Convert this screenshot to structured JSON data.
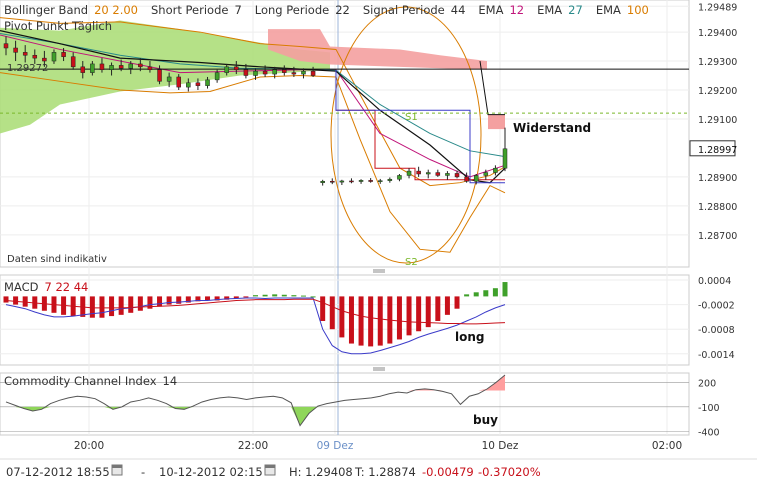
{
  "header_items": [
    {
      "label": "Bollinger Band",
      "params": "20  2.00",
      "label_color": "#333333",
      "param_color": "#d97c00"
    },
    {
      "label": "Short Periode",
      "params": "7",
      "label_color": "#333333",
      "param_color": "#333333"
    },
    {
      "label": "Long Periode",
      "params": "22",
      "label_color": "#333333",
      "param_color": "#333333"
    },
    {
      "label": "Signal Periode",
      "params": "44",
      "label_color": "#333333",
      "param_color": "#333333"
    },
    {
      "label": "EMA",
      "params": "12",
      "label_color": "#333333",
      "param_color": "#c0157a"
    },
    {
      "label": "EMA",
      "params": "27",
      "label_color": "#333333",
      "param_color": "#2a8a8a"
    },
    {
      "label": "EMA",
      "params": "100",
      "label_color": "#333333",
      "param_color": "#d97c00"
    }
  ],
  "pivot_label": "Pivot Punkt Täglich",
  "pivot_value_label": "1.29272",
  "note": "Daten sind indikativ",
  "annotations": {
    "s1": "S1",
    "s2": "S2",
    "widerstand": "Widerstand",
    "long": "long",
    "buy": "buy"
  },
  "macd_label": "MACD",
  "macd_params": "7  22  44",
  "cci_label": "Commodity Channel Index",
  "cci_params": "14",
  "time_labels": [
    "20:00",
    "22:00",
    "09 Dez",
    "10 Dez",
    "02:00"
  ],
  "footer": {
    "from": "07-12-2012 18:55",
    "dash": "-",
    "to": "10-12-2012 02:15",
    "high": "H: 1.29408",
    "low": "T: 1.28874",
    "change": "-0.00479",
    "change_pct": "-0.37020%"
  },
  "colors": {
    "up": "#3fa02a",
    "down": "#c8101a",
    "price_box": "#333333",
    "macd_line": "#3b3bc9",
    "macd_signal": "#c8101a",
    "cci_fill": "#8fd65a",
    "cci_neg_fill": "#ff9e9e",
    "cloud_green": "#a8dc72",
    "cloud_red": "#f4a0a0",
    "bollinger": "#d97c00"
  },
  "chart_data": [
    {
      "type": "candlestick",
      "title": "",
      "x_tick_labels": [
        "20:00",
        "22:00",
        "09 Dez",
        "10 Dez",
        "02:00"
      ],
      "y_tick_labels": [
        "1.29489",
        "1.29400",
        "1.29300",
        "1.29200",
        "1.29100",
        "1.28900",
        "1.28800",
        "1.28700"
      ],
      "ylim": [
        1.2862,
        1.2949
      ],
      "last_price": "1.28997",
      "pivot": 1.29272,
      "s1": 1.2912,
      "candles": [
        {
          "o": 1.2936,
          "h": 1.29385,
          "l": 1.2932,
          "c": 1.29345
        },
        {
          "o": 1.29345,
          "h": 1.2937,
          "l": 1.293,
          "c": 1.2933
        },
        {
          "o": 1.2933,
          "h": 1.29355,
          "l": 1.29295,
          "c": 1.2932
        },
        {
          "o": 1.2932,
          "h": 1.2934,
          "l": 1.2929,
          "c": 1.2931
        },
        {
          "o": 1.2931,
          "h": 1.29335,
          "l": 1.2928,
          "c": 1.293
        },
        {
          "o": 1.293,
          "h": 1.2934,
          "l": 1.2929,
          "c": 1.2933
        },
        {
          "o": 1.2933,
          "h": 1.29345,
          "l": 1.293,
          "c": 1.29315
        },
        {
          "o": 1.29315,
          "h": 1.2933,
          "l": 1.2927,
          "c": 1.2928
        },
        {
          "o": 1.2928,
          "h": 1.293,
          "l": 1.2924,
          "c": 1.2926
        },
        {
          "o": 1.2926,
          "h": 1.293,
          "l": 1.2925,
          "c": 1.2929
        },
        {
          "o": 1.2929,
          "h": 1.2931,
          "l": 1.2926,
          "c": 1.2927
        },
        {
          "o": 1.2927,
          "h": 1.29295,
          "l": 1.2925,
          "c": 1.29285
        },
        {
          "o": 1.29285,
          "h": 1.29305,
          "l": 1.29265,
          "c": 1.29275
        },
        {
          "o": 1.29275,
          "h": 1.293,
          "l": 1.29255,
          "c": 1.2929
        },
        {
          "o": 1.2929,
          "h": 1.2931,
          "l": 1.29265,
          "c": 1.2928
        },
        {
          "o": 1.2928,
          "h": 1.293,
          "l": 1.2926,
          "c": 1.2927
        },
        {
          "o": 1.2927,
          "h": 1.29285,
          "l": 1.2922,
          "c": 1.2923
        },
        {
          "o": 1.2923,
          "h": 1.2926,
          "l": 1.2921,
          "c": 1.29245
        },
        {
          "o": 1.29245,
          "h": 1.29255,
          "l": 1.292,
          "c": 1.2921
        },
        {
          "o": 1.2921,
          "h": 1.2924,
          "l": 1.29195,
          "c": 1.29225
        },
        {
          "o": 1.29225,
          "h": 1.2924,
          "l": 1.292,
          "c": 1.29215
        },
        {
          "o": 1.29215,
          "h": 1.29245,
          "l": 1.29205,
          "c": 1.29235
        },
        {
          "o": 1.29235,
          "h": 1.2927,
          "l": 1.29225,
          "c": 1.2926
        },
        {
          "o": 1.2926,
          "h": 1.2929,
          "l": 1.2925,
          "c": 1.2928
        },
        {
          "o": 1.2928,
          "h": 1.293,
          "l": 1.29255,
          "c": 1.2927
        },
        {
          "o": 1.2927,
          "h": 1.2929,
          "l": 1.2924,
          "c": 1.2925
        },
        {
          "o": 1.2925,
          "h": 1.29275,
          "l": 1.29235,
          "c": 1.29265
        },
        {
          "o": 1.29265,
          "h": 1.29285,
          "l": 1.29245,
          "c": 1.29255
        },
        {
          "o": 1.29255,
          "h": 1.2928,
          "l": 1.2924,
          "c": 1.2927
        },
        {
          "o": 1.2927,
          "h": 1.29285,
          "l": 1.2925,
          "c": 1.2926
        },
        {
          "o": 1.2926,
          "h": 1.2928,
          "l": 1.29245,
          "c": 1.29255
        },
        {
          "o": 1.29255,
          "h": 1.29275,
          "l": 1.2924,
          "c": 1.29265
        },
        {
          "o": 1.29265,
          "h": 1.2928,
          "l": 1.29245,
          "c": 1.2925
        },
        {
          "o": 1.2888,
          "h": 1.2889,
          "l": 1.2887,
          "c": 1.28885
        },
        {
          "o": 1.28885,
          "h": 1.28895,
          "l": 1.28875,
          "c": 1.28882
        },
        {
          "o": 1.28882,
          "h": 1.2889,
          "l": 1.28872,
          "c": 1.28886
        },
        {
          "o": 1.28886,
          "h": 1.28895,
          "l": 1.28878,
          "c": 1.28884
        },
        {
          "o": 1.28884,
          "h": 1.28892,
          "l": 1.28876,
          "c": 1.28888
        },
        {
          "o": 1.28888,
          "h": 1.28896,
          "l": 1.2888,
          "c": 1.28884
        },
        {
          "o": 1.28884,
          "h": 1.28893,
          "l": 1.28876,
          "c": 1.28887
        },
        {
          "o": 1.28887,
          "h": 1.28898,
          "l": 1.2888,
          "c": 1.28892
        },
        {
          "o": 1.28892,
          "h": 1.2891,
          "l": 1.28885,
          "c": 1.28905
        },
        {
          "o": 1.28905,
          "h": 1.2893,
          "l": 1.28895,
          "c": 1.2892
        },
        {
          "o": 1.2892,
          "h": 1.28935,
          "l": 1.289,
          "c": 1.2891
        },
        {
          "o": 1.2891,
          "h": 1.28925,
          "l": 1.28895,
          "c": 1.28915
        },
        {
          "o": 1.28915,
          "h": 1.28925,
          "l": 1.289,
          "c": 1.28905
        },
        {
          "o": 1.28905,
          "h": 1.2892,
          "l": 1.2889,
          "c": 1.28912
        },
        {
          "o": 1.28912,
          "h": 1.28922,
          "l": 1.28895,
          "c": 1.289
        },
        {
          "o": 1.289,
          "h": 1.28915,
          "l": 1.2888,
          "c": 1.28885
        },
        {
          "o": 1.28885,
          "h": 1.2891,
          "l": 1.28874,
          "c": 1.28905
        },
        {
          "o": 1.28905,
          "h": 1.28925,
          "l": 1.2889,
          "c": 1.28915
        },
        {
          "o": 1.28915,
          "h": 1.2894,
          "l": 1.28905,
          "c": 1.2893
        },
        {
          "o": 1.2893,
          "h": 1.2907,
          "l": 1.2892,
          "c": 1.28997
        }
      ]
    },
    {
      "type": "bar",
      "title": "MACD",
      "y_tick_labels": [
        "0.0004",
        "-0.0002",
        "-0.0008",
        "-0.0014"
      ],
      "ylim": [
        -0.0016,
        0.0004
      ],
      "histogram": [
        -0.00015,
        -0.0002,
        -0.00025,
        -0.0003,
        -0.00035,
        -0.0004,
        -0.00045,
        -0.00048,
        -0.0005,
        -0.00052,
        -0.00052,
        -0.00048,
        -0.00045,
        -0.0004,
        -0.00035,
        -0.0003,
        -0.00025,
        -0.0002,
        -0.00018,
        -0.00015,
        -0.00012,
        -0.0001,
        -0.0001,
        -8e-05,
        -5e-05,
        -2e-05,
        3e-05,
        4e-05,
        5e-05,
        4e-05,
        3e-05,
        2e-05,
        0.0,
        -0.0006,
        -0.0008,
        -0.001,
        -0.00115,
        -0.0012,
        -0.00122,
        -0.0012,
        -0.00115,
        -0.00105,
        -0.00095,
        -0.00085,
        -0.00075,
        -0.0006,
        -0.00045,
        -0.0003,
        5e-05,
        0.0001,
        0.00015,
        0.0002,
        0.00035
      ],
      "macd_line": [
        -0.0002,
        -0.00025,
        -0.0003,
        -0.00038,
        -0.00045,
        -0.0005,
        -0.0005,
        -0.00048,
        -0.00045,
        -0.00042,
        -0.0004,
        -0.00035,
        -0.0003,
        -0.00028,
        -0.00025,
        -0.0002,
        -0.00018,
        -0.00015,
        -0.00014,
        -0.00012,
        -0.0001,
        -0.0001,
        -8e-05,
        -6e-05,
        -5e-05,
        -4e-05,
        -4e-05,
        -5e-05,
        -4e-05,
        -4e-05,
        -4e-05,
        -4e-05,
        -4e-05,
        -0.0008,
        -0.0012,
        -0.00135,
        -0.0014,
        -0.0014,
        -0.00138,
        -0.00132,
        -0.00125,
        -0.00118,
        -0.0011,
        -0.001,
        -0.00092,
        -0.00085,
        -0.00078,
        -0.0007,
        -0.0006,
        -0.0005,
        -0.00038,
        -0.00028,
        -0.0002
      ],
      "signal_line": [
        -0.0001,
        -0.00012,
        -0.00014,
        -0.00016,
        -0.00018,
        -0.0002,
        -0.00022,
        -0.00024,
        -0.00026,
        -0.00028,
        -0.00028,
        -0.00028,
        -0.00028,
        -0.00027,
        -0.00026,
        -0.00025,
        -0.00024,
        -0.00023,
        -0.00022,
        -0.0002,
        -0.00018,
        -0.00016,
        -0.00014,
        -0.00012,
        -0.0001,
        -9e-05,
        -8e-05,
        -8e-05,
        -8e-05,
        -8e-05,
        -7e-05,
        -7e-05,
        -7e-05,
        -0.00015,
        -0.00025,
        -0.00035,
        -0.00042,
        -0.00048,
        -0.00052,
        -0.00055,
        -0.00058,
        -0.0006,
        -0.00062,
        -0.00063,
        -0.00064,
        -0.00065,
        -0.00066,
        -0.00066,
        -0.00067,
        -0.00067,
        -0.00066,
        -0.00065,
        -0.00064
      ]
    },
    {
      "type": "line",
      "title": "Commodity Channel Index",
      "y_tick_labels": [
        "200",
        "-100",
        "-400"
      ],
      "ylim": [
        -420,
        290
      ],
      "values": [
        -40,
        -80,
        -120,
        -150,
        -130,
        -60,
        -20,
        10,
        30,
        20,
        0,
        -60,
        -130,
        -100,
        -40,
        -20,
        10,
        -20,
        -60,
        -120,
        -130,
        -90,
        -40,
        -10,
        10,
        20,
        10,
        -10,
        10,
        20,
        30,
        10,
        -50,
        -330,
        -180,
        -90,
        -60,
        -40,
        -20,
        -10,
        0,
        10,
        30,
        60,
        80,
        70,
        110,
        120,
        110,
        90,
        60,
        -70,
        30,
        60,
        120,
        200,
        290
      ]
    }
  ]
}
